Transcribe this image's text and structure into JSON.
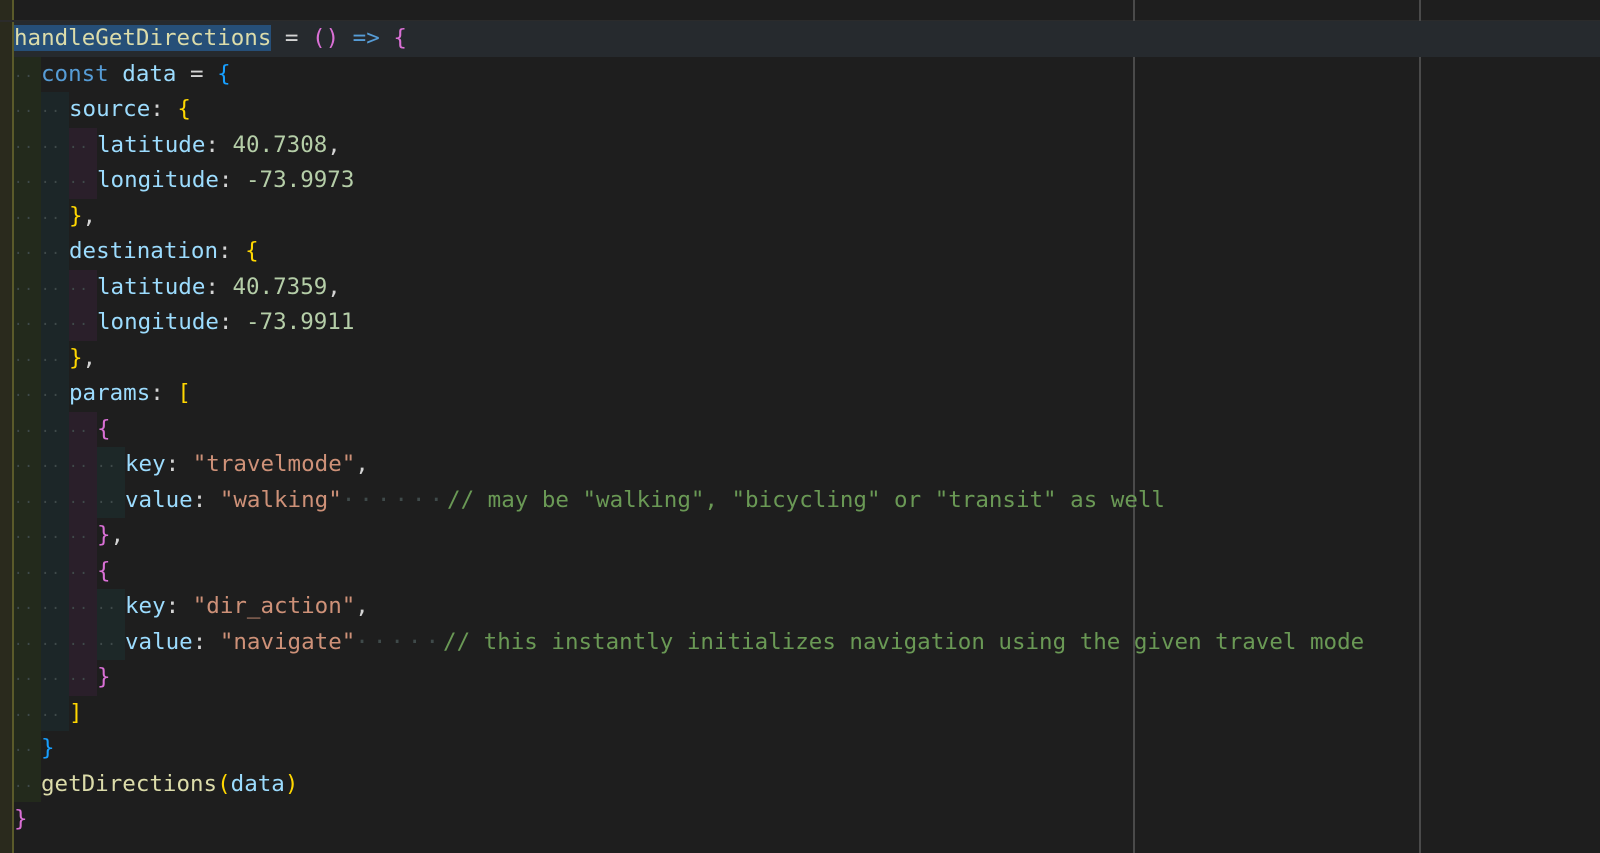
{
  "editor": {
    "lines": [
      {
        "indent": 0,
        "tokens": [
          {
            "t": "handleGetDirections",
            "c": "t-fn-hl"
          },
          {
            "t": " = ",
            "c": "t-op"
          },
          {
            "t": "()",
            "c": "t-b1"
          },
          {
            "t": " ",
            "c": "t-op"
          },
          {
            "t": "=>",
            "c": "t-arrow"
          },
          {
            "t": " ",
            "c": "t-op"
          },
          {
            "t": "{",
            "c": "t-b1"
          }
        ]
      },
      {
        "indent": 1,
        "tokens": [
          {
            "t": "const",
            "c": "t-kw"
          },
          {
            "t": " ",
            "c": "t-op"
          },
          {
            "t": "data",
            "c": "t-var"
          },
          {
            "t": " = ",
            "c": "t-op"
          },
          {
            "t": "{",
            "c": "t-b3"
          }
        ]
      },
      {
        "indent": 2,
        "tokens": [
          {
            "t": "source",
            "c": "t-prop"
          },
          {
            "t": ": ",
            "c": "t-punct"
          },
          {
            "t": "{",
            "c": "t-b2"
          }
        ]
      },
      {
        "indent": 3,
        "tokens": [
          {
            "t": "latitude",
            "c": "t-prop"
          },
          {
            "t": ": ",
            "c": "t-punct"
          },
          {
            "t": "40.7308",
            "c": "t-num"
          },
          {
            "t": ",",
            "c": "t-punct"
          }
        ]
      },
      {
        "indent": 3,
        "tokens": [
          {
            "t": "longitude",
            "c": "t-prop"
          },
          {
            "t": ": ",
            "c": "t-punct"
          },
          {
            "t": "-73.9973",
            "c": "t-num"
          }
        ]
      },
      {
        "indent": 2,
        "tokens": [
          {
            "t": "}",
            "c": "t-b2"
          },
          {
            "t": ",",
            "c": "t-punct"
          }
        ]
      },
      {
        "indent": 2,
        "tokens": [
          {
            "t": "destination",
            "c": "t-prop"
          },
          {
            "t": ": ",
            "c": "t-punct"
          },
          {
            "t": "{",
            "c": "t-b2"
          }
        ]
      },
      {
        "indent": 3,
        "tokens": [
          {
            "t": "latitude",
            "c": "t-prop"
          },
          {
            "t": ": ",
            "c": "t-punct"
          },
          {
            "t": "40.7359",
            "c": "t-num"
          },
          {
            "t": ",",
            "c": "t-punct"
          }
        ]
      },
      {
        "indent": 3,
        "tokens": [
          {
            "t": "longitude",
            "c": "t-prop"
          },
          {
            "t": ": ",
            "c": "t-punct"
          },
          {
            "t": "-73.9911",
            "c": "t-num"
          }
        ]
      },
      {
        "indent": 2,
        "tokens": [
          {
            "t": "}",
            "c": "t-b2"
          },
          {
            "t": ",",
            "c": "t-punct"
          }
        ]
      },
      {
        "indent": 2,
        "tokens": [
          {
            "t": "params",
            "c": "t-prop"
          },
          {
            "t": ": ",
            "c": "t-punct"
          },
          {
            "t": "[",
            "c": "t-b2"
          }
        ]
      },
      {
        "indent": 3,
        "tokens": [
          {
            "t": "{",
            "c": "t-b1"
          }
        ]
      },
      {
        "indent": 4,
        "tokens": [
          {
            "t": "key",
            "c": "t-prop"
          },
          {
            "t": ": ",
            "c": "t-punct"
          },
          {
            "t": "\"travelmode\"",
            "c": "t-str"
          },
          {
            "t": ",",
            "c": "t-punct"
          }
        ]
      },
      {
        "indent": 4,
        "tokens": [
          {
            "t": "value",
            "c": "t-prop"
          },
          {
            "t": ": ",
            "c": "t-punct"
          },
          {
            "t": "\"walking\"",
            "c": "t-str"
          },
          {
            "t": "······",
            "c": "ws"
          },
          {
            "t": "// may be \"walking\", \"bicycling\" or \"transit\" as well",
            "c": "t-cmt"
          }
        ]
      },
      {
        "indent": 3,
        "tokens": [
          {
            "t": "}",
            "c": "t-b1"
          },
          {
            "t": ",",
            "c": "t-punct"
          }
        ]
      },
      {
        "indent": 3,
        "tokens": [
          {
            "t": "{",
            "c": "t-b1"
          }
        ]
      },
      {
        "indent": 4,
        "tokens": [
          {
            "t": "key",
            "c": "t-prop"
          },
          {
            "t": ": ",
            "c": "t-punct"
          },
          {
            "t": "\"dir_action\"",
            "c": "t-str"
          },
          {
            "t": ",",
            "c": "t-punct"
          }
        ]
      },
      {
        "indent": 4,
        "tokens": [
          {
            "t": "value",
            "c": "t-prop"
          },
          {
            "t": ": ",
            "c": "t-punct"
          },
          {
            "t": "\"navigate\"",
            "c": "t-str"
          },
          {
            "t": "·····",
            "c": "ws"
          },
          {
            "t": "// this instantly initializes navigation using the given travel mode",
            "c": "t-cmt"
          }
        ]
      },
      {
        "indent": 3,
        "tokens": [
          {
            "t": "}",
            "c": "t-b1"
          }
        ]
      },
      {
        "indent": 2,
        "tokens": [
          {
            "t": "]",
            "c": "t-b2"
          }
        ]
      },
      {
        "indent": 1,
        "tokens": [
          {
            "t": "}",
            "c": "t-b3"
          }
        ]
      },
      {
        "indent": 1,
        "tokens": [
          {
            "t": "getDirections",
            "c": "t-fn"
          },
          {
            "t": "(",
            "c": "t-b2"
          },
          {
            "t": "data",
            "c": "t-var"
          },
          {
            "t": ")",
            "c": "t-b2"
          }
        ]
      },
      {
        "indent": 0,
        "tokens": [
          {
            "t": "}",
            "c": "t-b1"
          }
        ]
      }
    ]
  },
  "colors": {
    "background": "#1e1e1e",
    "function": "#dcdcaa",
    "keyword": "#569cd6",
    "property": "#9cdcfe",
    "number": "#b5cea8",
    "string": "#ce9178",
    "comment": "#6a9955",
    "bracket_magenta": "#da70d6",
    "bracket_gold": "#ffd700",
    "bracket_blue": "#179fff"
  }
}
